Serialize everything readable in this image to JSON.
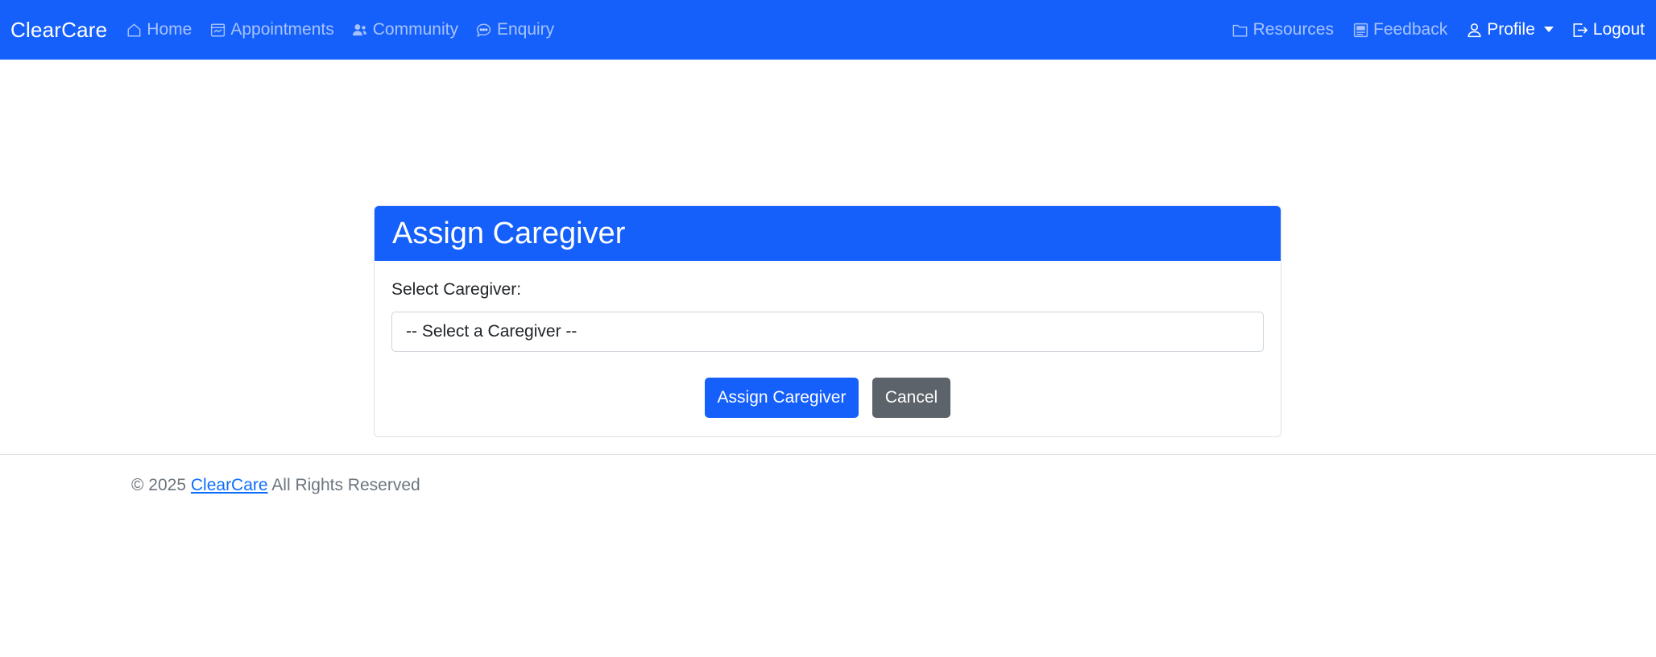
{
  "navbar": {
    "brand": "ClearCare",
    "left_links": [
      {
        "label": "Home",
        "icon": "house-icon"
      },
      {
        "label": "Appointments",
        "icon": "calendar-icon"
      },
      {
        "label": "Community",
        "icon": "people-icon"
      },
      {
        "label": "Enquiry",
        "icon": "chat-icon"
      }
    ],
    "right_links": [
      {
        "label": "Resources",
        "icon": "folder-icon"
      },
      {
        "label": "Feedback",
        "icon": "feedback-icon"
      },
      {
        "label": "Profile",
        "icon": "person-icon"
      },
      {
        "label": "Logout",
        "icon": "logout-icon"
      }
    ]
  },
  "card": {
    "title": "Assign Caregiver",
    "select_label": "Select Caregiver:",
    "select_value": "-- Select a Caregiver --",
    "assign_button": "Assign Caregiver",
    "cancel_button": "Cancel"
  },
  "footer": {
    "prefix": "© 2025",
    "link": "ClearCare",
    "suffix": "All Rights Reserved"
  },
  "colors": {
    "primary": "#1560fb",
    "secondary": "#5c636a",
    "link": "#0d6efd"
  }
}
